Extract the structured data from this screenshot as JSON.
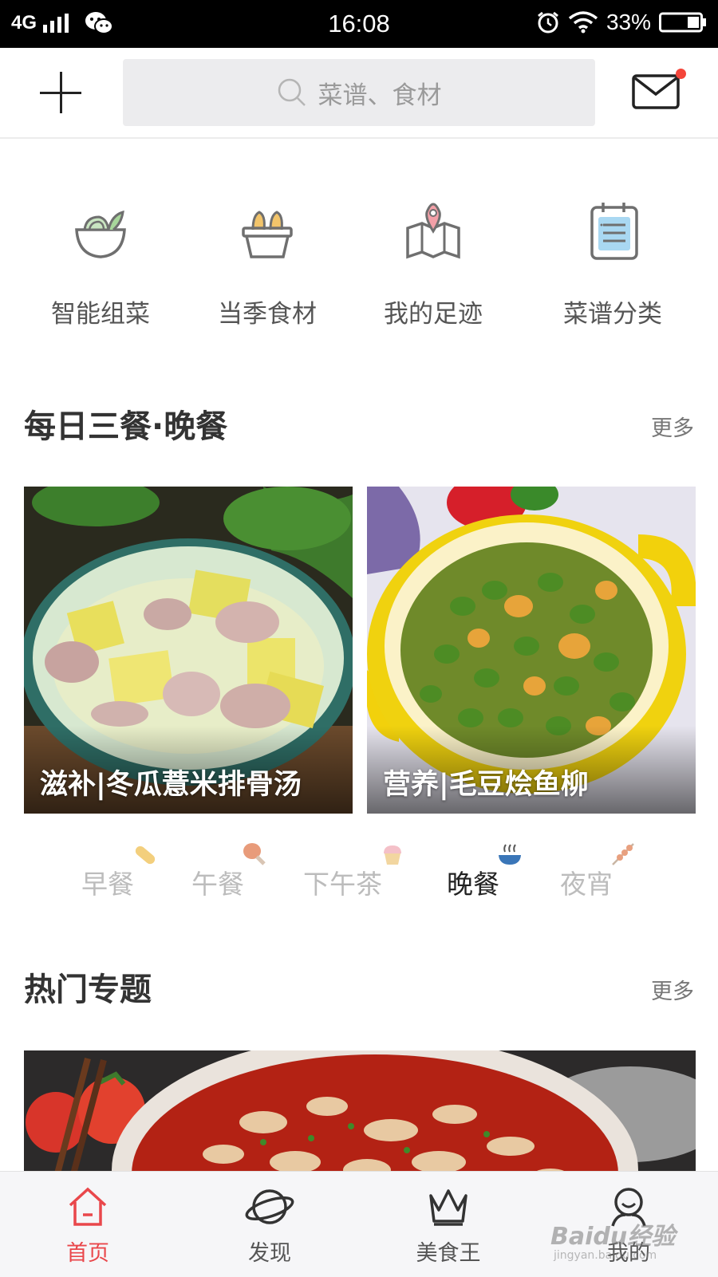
{
  "status_bar": {
    "network": "4G",
    "time": "16:08",
    "battery": "33%"
  },
  "top_nav": {
    "search_placeholder": "菜谱、食材"
  },
  "quick_entries": [
    {
      "label": "智能组菜",
      "icon": "salad-bowl-icon"
    },
    {
      "label": "当季食材",
      "icon": "basket-icon"
    },
    {
      "label": "我的足迹",
      "icon": "map-pin-icon"
    },
    {
      "label": "菜谱分类",
      "icon": "notebook-icon"
    }
  ],
  "daily_meals": {
    "title": "每日三餐·晚餐",
    "more": "更多",
    "cards": [
      {
        "caption": "滋补|冬瓜薏米排骨汤"
      },
      {
        "caption": "营养|毛豆烩鱼柳"
      }
    ],
    "tabs": [
      {
        "label": "早餐",
        "icon": "bread-icon",
        "active": false
      },
      {
        "label": "午餐",
        "icon": "drumstick-icon",
        "active": false
      },
      {
        "label": "下午茶",
        "icon": "cupcake-icon",
        "active": false
      },
      {
        "label": "晚餐",
        "icon": "steaming-bowl-icon",
        "active": true
      },
      {
        "label": "夜宵",
        "icon": "skewer-icon",
        "active": false
      }
    ]
  },
  "hot_topics": {
    "title": "热门专题",
    "more": "更多"
  },
  "tab_bar": [
    {
      "label": "首页",
      "icon": "home-icon",
      "active": true
    },
    {
      "label": "发现",
      "icon": "planet-icon",
      "active": false
    },
    {
      "label": "美食王",
      "icon": "crown-icon",
      "active": false
    },
    {
      "label": "我的",
      "icon": "user-icon",
      "active": false
    }
  ],
  "watermark": {
    "text": "Baidu经验",
    "sub": "jingyan.baidu.com"
  },
  "colors": {
    "accent": "#e9474b",
    "icon_gray": "#6f6f6f",
    "inactive_tab": "#bcbcbc"
  }
}
